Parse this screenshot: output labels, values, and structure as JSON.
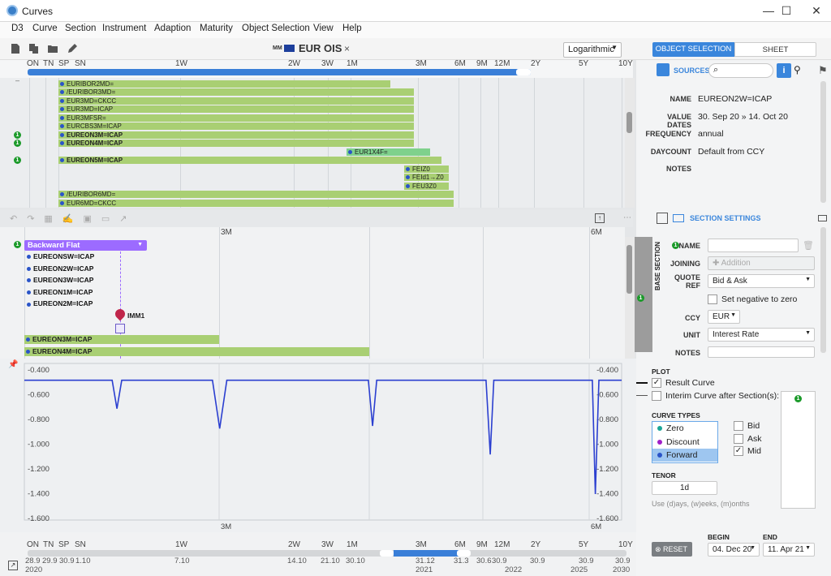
{
  "window": {
    "title": "Curves",
    "minimize": "—",
    "maximize": "☐",
    "close": "✕"
  },
  "menu": [
    "D3",
    "Curve",
    "Section",
    "Instrument",
    "Adaption",
    "Maturity",
    "Object Selection",
    "View",
    "Help"
  ],
  "toolbar": {
    "doc_badge": "MM",
    "doc_title": "EUR OIS",
    "doc_close": "×",
    "scale": "Logarithmic",
    "tab_object_selection": "OBJECT SELECTION",
    "tab_sheet": "SHEET"
  },
  "timeline_top": [
    "ON",
    "TN",
    "SP",
    "SN",
    "1W",
    "2W",
    "3W",
    "1M",
    "3M",
    "6M",
    "9M",
    "12M",
    "2Y",
    "5Y",
    "10Y"
  ],
  "instruments": [
    {
      "label": "EURIBOR2MD=",
      "badge": ""
    },
    {
      "label": "/EURIBOR3MD=",
      "badge": ""
    },
    {
      "label": "EUR3MD=CKCC",
      "badge": ""
    },
    {
      "label": "EUR3MD=ICAP",
      "badge": ""
    },
    {
      "label": "EUR3MFSR=",
      "badge": ""
    },
    {
      "label": "EURCBS3M=ICAP",
      "badge": ""
    },
    {
      "label": "EUREON3M=ICAP",
      "badge": "1"
    },
    {
      "label": "EUREON4M=ICAP",
      "badge": "1"
    },
    {
      "label": "EUR1X4F=",
      "badge": ""
    },
    {
      "label": "EUREON5M=ICAP",
      "badge": "1"
    },
    {
      "label": "FEIZ0",
      "badge": ""
    },
    {
      "label": "FEId1→Z0",
      "badge": ""
    },
    {
      "label": "FEU3Z0",
      "badge": ""
    },
    {
      "label": "/EURIBOR6MD=",
      "badge": ""
    },
    {
      "label": "EUR6MD=CKCC",
      "badge": ""
    }
  ],
  "sources": {
    "label": "SOURCES",
    "fields": {
      "name_label": "NAME",
      "name": "EUREON2W=ICAP",
      "value_dates_label": "VALUE DATES",
      "value_dates": "30. Sep 20 » 14. Oct 20",
      "frequency_label": "FREQUENCY",
      "frequency": "annual",
      "daycount_label": "DAYCOUNT",
      "daycount": "Default from CCY",
      "notes_label": "NOTES"
    }
  },
  "section": {
    "axis_3m": "3M",
    "axis_6m": "6M",
    "header_badge": "1",
    "name": "Backward Flat",
    "instruments": [
      "EUREONSW=ICAP",
      "EUREON2W=ICAP",
      "EUREON3W=ICAP",
      "EUREON1M=ICAP",
      "EUREON2M=ICAP"
    ],
    "imm": "IMM1",
    "bars": [
      "EUREON3M=ICAP",
      "EUREON4M=ICAP"
    ]
  },
  "section_settings": {
    "title": "SECTION SETTINGS",
    "base_section": "BASE SECTION",
    "name_label": "NAME",
    "name_badge": "1",
    "joining_label": "JOINING",
    "joining_value": "Addition",
    "quote_ref_label": "QUOTE REF",
    "quote_ref": "Bid & Ask",
    "set_negative": "Set negative to zero",
    "ccy_label": "CCY",
    "ccy": "EUR",
    "unit_label": "UNIT",
    "unit": "Interest Rate",
    "notes_label": "NOTES",
    "side_badge": "1"
  },
  "chart_data": {
    "type": "line",
    "y_ticks": [
      "-0.400",
      "-0.600",
      "-0.800",
      "-1.000",
      "-1.200",
      "-1.400",
      "-1.600"
    ],
    "ylim": [
      -1.6,
      -0.4
    ],
    "x_ticks": [
      "3M",
      "6M"
    ],
    "series": [
      {
        "name": "Result Curve",
        "x": [
          0,
          0.147,
          0.155,
          0.163,
          0.315,
          0.327,
          0.339,
          0.576,
          0.583,
          0.59,
          0.773,
          0.78,
          0.786,
          0.951,
          0.956,
          0.962,
          1
        ],
        "values": [
          -0.49,
          -0.49,
          -0.72,
          -0.49,
          -0.49,
          -0.88,
          -0.49,
          -0.49,
          -0.86,
          -0.49,
          -0.49,
          -1.09,
          -0.49,
          -0.49,
          -1.41,
          -0.49,
          -0.49
        ]
      }
    ],
    "color": "#2b3fd0"
  },
  "plot_panel": {
    "plot_label": "PLOT",
    "result_curve": "Result Curve",
    "interim_curve": "Interim Curve after Section(s):",
    "curve_types_label": "CURVE TYPES",
    "curve_types": [
      "Zero",
      "Discount",
      "Forward"
    ],
    "curve_type_colors": [
      "#1aa596",
      "#a020c8",
      "#2a54c8"
    ],
    "bid": "Bid",
    "ask": "Ask",
    "mid": "Mid",
    "tenor_label": "TENOR",
    "tenor": "1d",
    "tenor_hint": "Use (d)ays, (w)eeks, (m)onths",
    "interim_badge": "1"
  },
  "timeline_bottom": {
    "tenors": [
      "ON",
      "TN",
      "SP",
      "SN",
      "1W",
      "2W",
      "3W",
      "1M",
      "3M",
      "6M",
      "9M",
      "12M",
      "2Y",
      "5Y",
      "10Y"
    ],
    "dates": [
      "28.9",
      "29.9",
      "30.9",
      "1.10",
      "7.10",
      "14.10",
      "21.10",
      "30.10",
      "31.12",
      "31.3",
      "30.6",
      "30.9",
      "30.9",
      "30.9",
      "30.9"
    ],
    "years": [
      "2020",
      "2021",
      "2022",
      "2025",
      "2030"
    ],
    "reset": "RESET",
    "begin_label": "BEGIN",
    "begin": "04. Dec 20",
    "end_label": "END",
    "end": "11. Apr 21"
  }
}
